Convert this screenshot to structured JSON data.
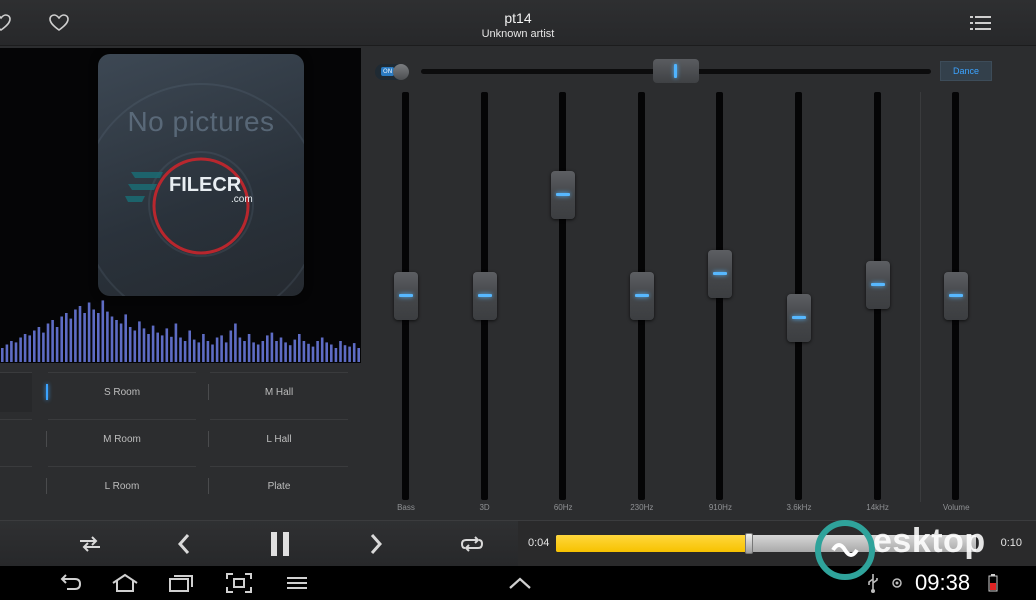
{
  "header": {
    "title": "pt14",
    "artist": "Unknown artist",
    "icons": [
      "heart-outline-icon",
      "heart-outline-icon",
      "menu-list-icon"
    ]
  },
  "album": {
    "placeholder_text": "No pictures",
    "watermark_logo": "FILECR",
    "watermark_sub": ".com"
  },
  "spectrum": {
    "color": "#6e7fe6",
    "levels": [
      0.2,
      0.25,
      0.3,
      0.28,
      0.35,
      0.4,
      0.38,
      0.45,
      0.5,
      0.42,
      0.55,
      0.6,
      0.5,
      0.65,
      0.7,
      0.62,
      0.75,
      0.8,
      0.7,
      0.85,
      0.75,
      0.7,
      0.88,
      0.72,
      0.65,
      0.6,
      0.55,
      0.68,
      0.5,
      0.45,
      0.58,
      0.48,
      0.4,
      0.52,
      0.42,
      0.38,
      0.48,
      0.36,
      0.55,
      0.35,
      0.3,
      0.45,
      0.32,
      0.28,
      0.4,
      0.3,
      0.25,
      0.35,
      0.38,
      0.28,
      0.45,
      0.55,
      0.35,
      0.3,
      0.4,
      0.28,
      0.25,
      0.3,
      0.38,
      0.42,
      0.3,
      0.35,
      0.28,
      0.24,
      0.32,
      0.4,
      0.3,
      0.26,
      0.22,
      0.3,
      0.35,
      0.28,
      0.25,
      0.2,
      0.3,
      0.24,
      0.22,
      0.27,
      0.2
    ]
  },
  "reverb": {
    "presets": [
      {
        "label": "S Room",
        "selected": true
      },
      {
        "label": "M Hall",
        "selected": false
      },
      {
        "label": "M Room",
        "selected": false
      },
      {
        "label": "L Hall",
        "selected": false
      },
      {
        "label": "L Room",
        "selected": false
      },
      {
        "label": "Plate",
        "selected": false
      }
    ]
  },
  "equalizer": {
    "enabled_label": "ON",
    "preset": "Dance",
    "balance": 0.5,
    "accent": "#3ba3ff",
    "bands": [
      {
        "label": "Bass",
        "level": 0.5
      },
      {
        "label": "3D",
        "level": 0.5
      },
      {
        "label": "60Hz",
        "level": 0.78
      },
      {
        "label": "230Hz",
        "level": 0.5
      },
      {
        "label": "910Hz",
        "level": 0.56
      },
      {
        "label": "3.6kHz",
        "level": 0.44
      },
      {
        "label": "14kHz",
        "level": 0.53
      },
      {
        "label": "Volume",
        "level": 0.5
      }
    ]
  },
  "player": {
    "elapsed": "0:04",
    "total": "0:10",
    "progress": 0.46,
    "progress_color": "#f7c200",
    "controls": [
      "shuffle-icon",
      "previous-icon",
      "pause-icon",
      "next-icon",
      "repeat-icon"
    ]
  },
  "system": {
    "clock": "09:38",
    "nav_icons": [
      "back-icon",
      "home-icon",
      "recent-apps-icon",
      "screenshot-icon",
      "menu-icon",
      "chevron-up-icon",
      "usb-icon",
      "status-icon",
      "battery-icon"
    ]
  },
  "watermark": {
    "text": "esktop",
    "brand_color": "#2fa39b"
  }
}
